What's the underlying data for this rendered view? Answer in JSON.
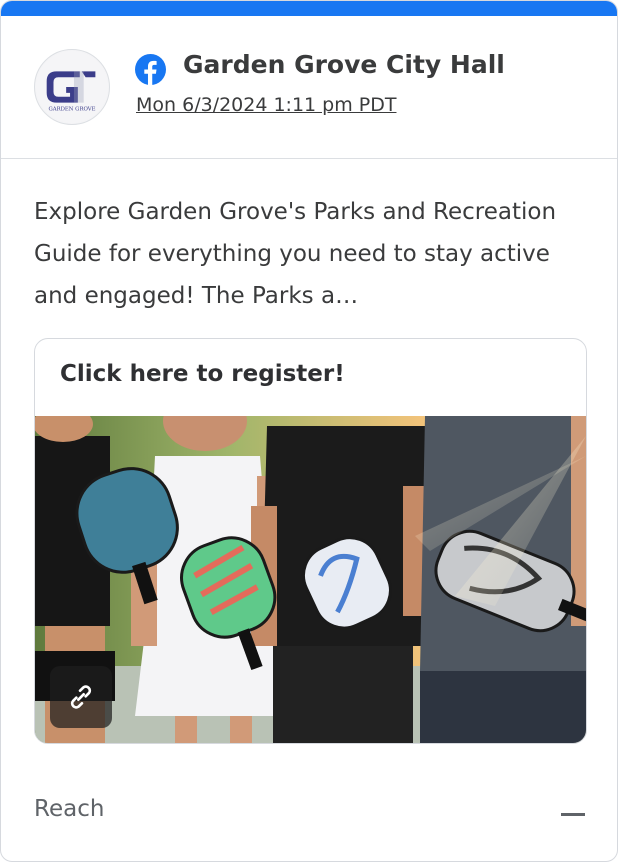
{
  "post": {
    "page_name": "Garden Grove City Hall",
    "timestamp": "Mon 6/3/2024 1:11 pm PDT",
    "network_icon": "facebook-icon",
    "avatar_logo": "garden-grove-logo",
    "text": "Explore Garden Grove's Parks and Recreation Guide for everything you need to stay active and engaged! The Parks a…"
  },
  "link_preview": {
    "title": "Click here to register!",
    "image": "people-holding-pickleball-paddles",
    "badge_icon": "link-icon"
  },
  "metrics": {
    "reach_label": "Reach",
    "toggle_icon": "collapse-minus-icon"
  },
  "colors": {
    "brand_blue": "#1877f2",
    "text": "#3a3b3c",
    "border": "#d6d9de"
  }
}
